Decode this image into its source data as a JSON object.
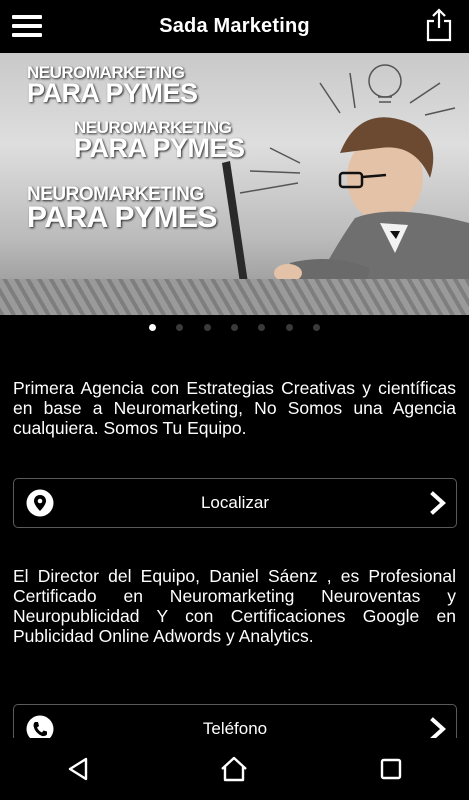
{
  "app": {
    "title": "Sada Marketing"
  },
  "header": {
    "menu_icon": "hamburger-menu-icon",
    "share_icon": "share-icon"
  },
  "banner": {
    "lines": [
      {
        "top": "NEUROMARKETING",
        "bottom": "PARA PYMES"
      },
      {
        "top": "NEUROMARKETING",
        "bottom": "PARA PYMES"
      },
      {
        "top": "NEUROMARKETING",
        "bottom": "PARA PYMES"
      }
    ],
    "dots_total": 7,
    "dot_active_index": 0
  },
  "content": {
    "intro": "Primera Agencia con Estrategias Creativas y científicas en base a Neuromarketing, No Somos una Agencia cualquiera. Somos Tu Equipo.",
    "director": "El Director del Equipo, Daniel Sáenz , es Profesional Certificado en Neuromarketing Neuroventas y Neuropublicidad Y con Certificaciones Google en Publicidad Online Adwords y Analytics."
  },
  "actions": {
    "locate": {
      "label": "Localizar",
      "icon": "location-pin-icon"
    },
    "phone": {
      "label": "Teléfono",
      "icon": "phone-icon"
    }
  },
  "navbar": {
    "back_icon": "back-triangle-icon",
    "home_icon": "home-icon",
    "recents_icon": "recents-square-icon"
  }
}
